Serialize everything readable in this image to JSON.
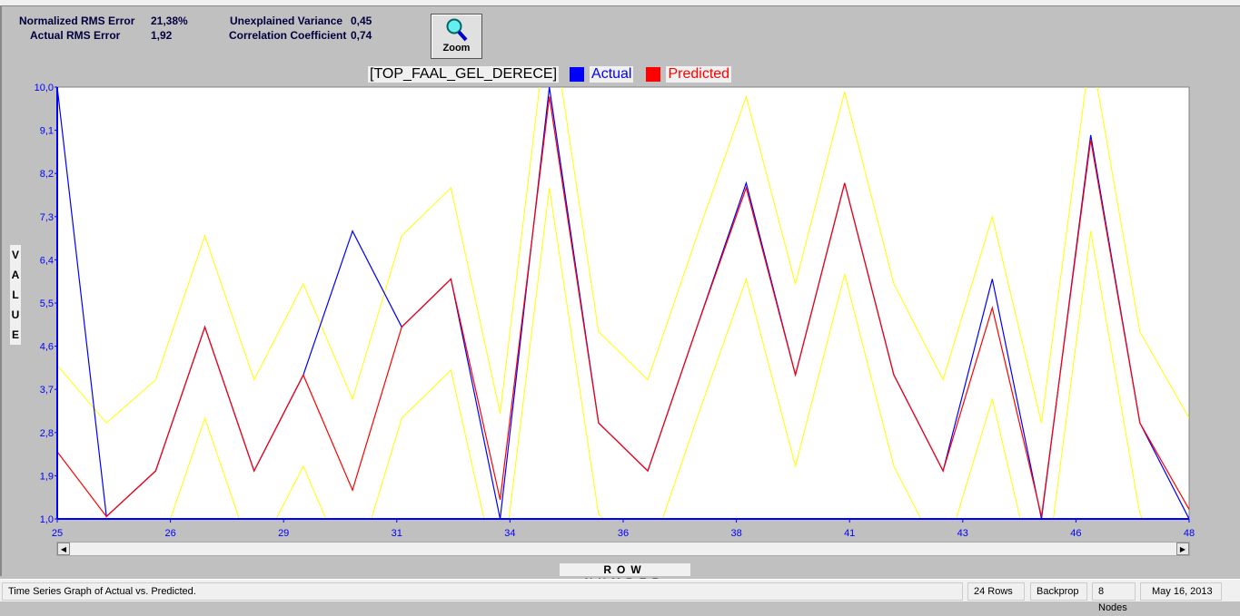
{
  "stats": {
    "normalized_rms_label": "Normalized RMS Error",
    "normalized_rms_value": "21,38%",
    "actual_rms_label": "Actual RMS Error",
    "actual_rms_value": "1,92",
    "unexplained_variance_label": "Unexplained Variance",
    "unexplained_variance_value": "0,45",
    "correlation_label": "Correlation Coefficient",
    "correlation_value": "0,74"
  },
  "zoom_button": {
    "label": "Zoom",
    "icon": "magnifier-icon"
  },
  "status_bar": {
    "message": "Time Series Graph of Actual vs. Predicted.",
    "rows": "24 Rows",
    "algorithm": "Backprop",
    "nodes": "8 Nodes",
    "date": "May 16, 2013"
  },
  "chart_data": {
    "type": "line",
    "title": "[TOP_FAAL_GEL_DERECE]",
    "xlabel": "ROW NUMBER",
    "ylabel": "VALUE",
    "ylim": [
      1.0,
      10.0
    ],
    "xlim": [
      25,
      48
    ],
    "yticks": [
      "1,0",
      "1,9",
      "2,8",
      "3,7",
      "4,6",
      "5,5",
      "6,4",
      "7,3",
      "8,2",
      "9,1",
      "10,0"
    ],
    "xticks": [
      "25",
      "26",
      "29",
      "31",
      "34",
      "36",
      "38",
      "41",
      "43",
      "46",
      "48"
    ],
    "xtick_values": [
      25,
      27.3,
      29.6,
      31.9,
      34.2,
      36.5,
      38.8,
      41.1,
      43.4,
      45.7,
      48
    ],
    "legend": "top",
    "x": [
      25,
      26,
      27,
      28,
      29,
      30,
      31,
      32,
      33,
      34,
      35,
      36,
      37,
      38,
      39,
      40,
      41,
      42,
      43,
      44,
      45,
      46,
      47,
      48
    ],
    "series": [
      {
        "name": "Actual",
        "color": "#0000ff",
        "values": [
          10,
          1.05,
          2,
          5,
          2,
          4,
          7,
          5,
          6,
          1,
          10,
          3,
          2,
          5,
          8,
          4,
          8,
          4,
          2,
          6,
          1,
          9,
          3,
          1
        ]
      },
      {
        "name": "Predicted",
        "color": "#ff0000",
        "values": [
          2.4,
          1.05,
          2,
          5,
          2,
          4,
          1.6,
          5,
          6,
          1.4,
          9.8,
          3,
          2,
          5,
          7.9,
          4,
          8,
          4,
          2,
          5.4,
          1.05,
          8.9,
          3,
          1.2
        ]
      }
    ],
    "confidence_band": {
      "color": "#ffff00",
      "upper": [
        4.2,
        3.0,
        3.9,
        6.9,
        3.9,
        5.9,
        3.5,
        6.9,
        7.9,
        3.2,
        11.7,
        4.9,
        3.9,
        6.9,
        9.8,
        5.9,
        9.9,
        5.9,
        3.9,
        7.3,
        3.0,
        10.8,
        4.9,
        3.1
      ],
      "lower": [
        0.5,
        -0.9,
        0.1,
        3.1,
        0.1,
        2.1,
        -0.3,
        3.1,
        4.1,
        -0.5,
        7.9,
        1.1,
        0.1,
        3.1,
        6.0,
        2.1,
        6.1,
        2.1,
        0.1,
        3.5,
        -0.9,
        7.0,
        1.1,
        -0.7
      ]
    }
  }
}
